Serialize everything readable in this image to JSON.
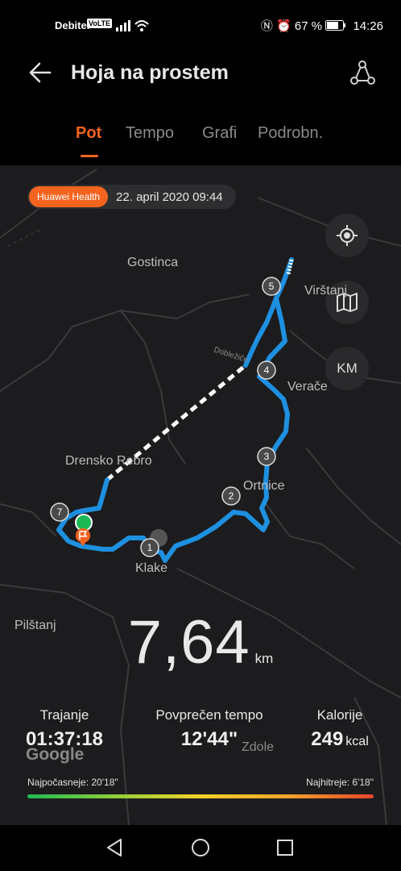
{
  "status_bar": {
    "carrier": "Debitel",
    "volte": "VoLTE",
    "battery": "67 %",
    "time": "14:26"
  },
  "header": {
    "title": "Hoja na prostem"
  },
  "tabs": [
    {
      "label": "Pot",
      "active": true
    },
    {
      "label": "Tempo",
      "active": false
    },
    {
      "label": "Grafi",
      "active": false
    },
    {
      "label": "Podrobn.",
      "active": false
    }
  ],
  "map": {
    "source_badge": "Huawei Health",
    "date": "22. april 2020 09:44",
    "places": [
      "Gostinca",
      "Virštanj",
      "Verače",
      "Drensko Rebro",
      "Ortnice",
      "Klake",
      "Pilštanj",
      "Zdole"
    ],
    "road_label": "Dobležiče",
    "watermark": "Google",
    "controls": {
      "locate": "locate-icon",
      "layers": "map-icon",
      "unit": "KM"
    },
    "markers": [
      "1",
      "2",
      "3",
      "4",
      "5",
      "7"
    ]
  },
  "summary": {
    "distance_value": "7,64",
    "distance_unit": "km",
    "duration_label": "Trajanje",
    "duration_value": "01:37:18",
    "pace_label": "Povprečen tempo",
    "pace_value": "12'44\"",
    "calories_label": "Kalorije",
    "calories_value": "249",
    "calories_unit": "kcal"
  },
  "pace_legend": {
    "slowest": "Najpočasneje: 20'18\"",
    "fastest": "Najhitreje: 6'18\""
  },
  "colors": {
    "accent": "#f5641e",
    "route": "#1e90e0",
    "pace_fast": "#e5452a",
    "pace_slow": "#1db954"
  }
}
